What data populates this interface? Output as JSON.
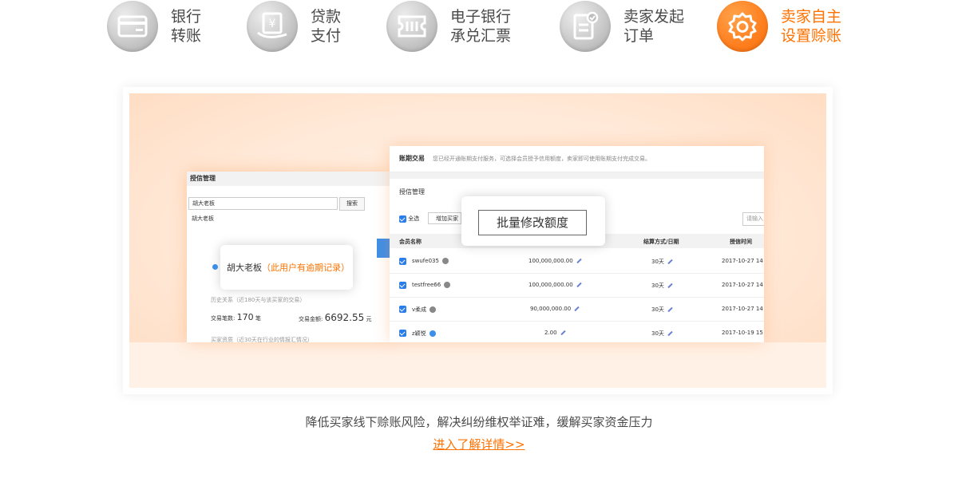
{
  "tabs": [
    {
      "line1": "银行",
      "line2": "转账",
      "icon": "bank-card-icon",
      "active": false
    },
    {
      "line1": "贷款",
      "line2": "支付",
      "icon": "loan-yuan-icon",
      "active": false
    },
    {
      "line1": "电子银行",
      "line2": "承兑汇票",
      "icon": "e-bill-icon",
      "active": false
    },
    {
      "line1": "卖家发起",
      "line2": "订单",
      "icon": "order-check-icon",
      "active": false
    },
    {
      "line1": "卖家自主",
      "line2": "设置赊账",
      "icon": "settings-gear-icon",
      "active": true
    }
  ],
  "colors": {
    "accent": "#ff7200",
    "inactive_icon": "#bdbdbd",
    "text": "#4a4a4a"
  },
  "screen_left": {
    "header": "授信管理",
    "search_value": "胡大老板",
    "search_button": "搜索",
    "search_result": "胡大老板",
    "history": "历史关系（近180天与该买家的交易）",
    "trade_count_label": "交易笔数:",
    "trade_count": "170",
    "trade_count_unit": "笔",
    "trade_amount_label": "交易金额:",
    "trade_amount": "6692.55",
    "trade_amount_unit": "元",
    "history2": "买家资质（近30天在行业的情报汇情况）"
  },
  "popup_user": {
    "name": "胡大老板",
    "warning": "（此用户有逾期记录）"
  },
  "screen_right": {
    "title": "账期交易",
    "notice": "您已经开通账期支付服务，可选择会员授予信用额度，卖家即可使用账期支付完成交易。",
    "section": "授信管理",
    "select_all": "全选",
    "add_button": "增加买家",
    "search_placeholder": "请输入",
    "columns": {
      "member": "会员名称",
      "settle": "结算方式/日期",
      "time": "授信时间"
    },
    "rows": [
      {
        "name": "swufe035",
        "amount": "100,000,000.00",
        "term": "30天",
        "date": "2017-10-27 14",
        "icon": "gray"
      },
      {
        "name": "testfree66",
        "amount": "100,000,000.00",
        "term": "30天",
        "date": "2017-10-27 14",
        "icon": "gray"
      },
      {
        "name": "v柔成",
        "amount": "90,000,000.00",
        "term": "30天",
        "date": "2017-10-27 14",
        "icon": "gray"
      },
      {
        "name": "z颖悦",
        "amount": "2.00",
        "term": "30天",
        "date": "2017-10-19 15",
        "icon": "blue"
      }
    ]
  },
  "popup_batch": {
    "button": "批量修改额度"
  },
  "footer": {
    "description": "降低买家线下赊账风险，解决纠纷维权举证难，缓解买家资金压力",
    "link": "进入了解详情>>"
  }
}
